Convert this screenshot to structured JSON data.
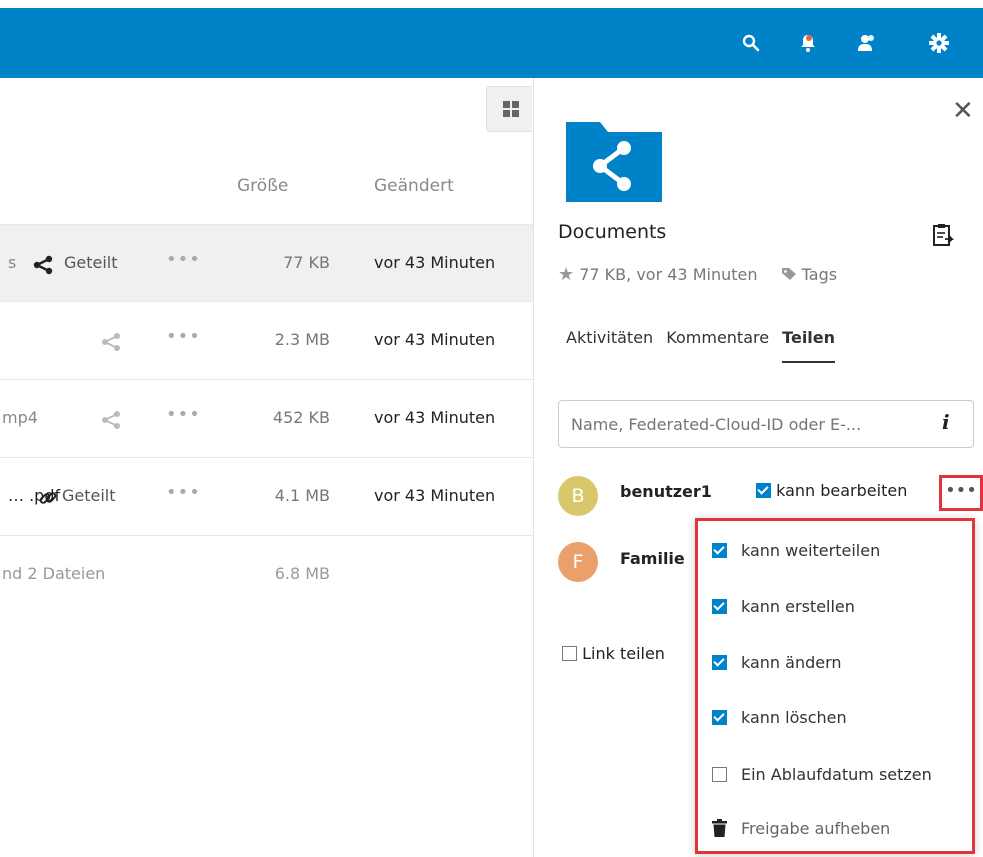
{
  "header": {
    "icons": [
      "search-icon",
      "notifications-icon",
      "contacts-icon",
      "settings-icon"
    ],
    "accent": "#0082c9",
    "badge_color": "#e9633b"
  },
  "filelist": {
    "columns": {
      "size": "Größe",
      "modified": "Geändert"
    },
    "rows": [
      {
        "name_fragment": "s",
        "share_label": "Geteilt",
        "more": "•••",
        "size": "77 KB",
        "modified": "vor 43 Minuten"
      },
      {
        "name_fragment": "",
        "share_label": "",
        "more": "•••",
        "size": "2.3 MB",
        "modified": "vor 43 Minuten"
      },
      {
        "name_fragment": "mp4",
        "share_label": "",
        "more": "•••",
        "size": "452 KB",
        "modified": "vor 43 Minuten"
      },
      {
        "name_fragment": "… .pdf",
        "share_label": "Geteilt",
        "more": "•••",
        "size": "4.1 MB",
        "modified": "vor 43 Minuten"
      }
    ],
    "summary": {
      "text": "nd 2 Dateien",
      "size": "6.8 MB"
    }
  },
  "sidebar": {
    "close": "✕",
    "title": "Documents",
    "meta": {
      "info": "77 KB, vor 43 Minuten",
      "tags": "Tags"
    },
    "tabs": [
      {
        "label": "Aktivitäten"
      },
      {
        "label": "Kommentare"
      },
      {
        "label": "Teilen"
      }
    ],
    "share_placeholder": "Name, Federated-Cloud-ID oder E-...",
    "info_glyph": "i",
    "shares": [
      {
        "initial": "B",
        "name": "benutzer1",
        "avatar_color": "#d8c86b",
        "permission": "kann bearbeiten",
        "more": "•••"
      },
      {
        "initial": "F",
        "name": "Familie",
        "avatar_color": "#e9a06b"
      }
    ],
    "link_share": "Link teilen"
  },
  "popup": {
    "items": [
      {
        "label": "kann weiterteilen",
        "checked": true
      },
      {
        "label": "kann erstellen",
        "checked": true
      },
      {
        "label": "kann ändern",
        "checked": true
      },
      {
        "label": "kann löschen",
        "checked": true
      },
      {
        "label": "Ein Ablaufdatum setzen",
        "checked": false
      },
      {
        "label": "Freigabe aufheben"
      }
    ]
  }
}
